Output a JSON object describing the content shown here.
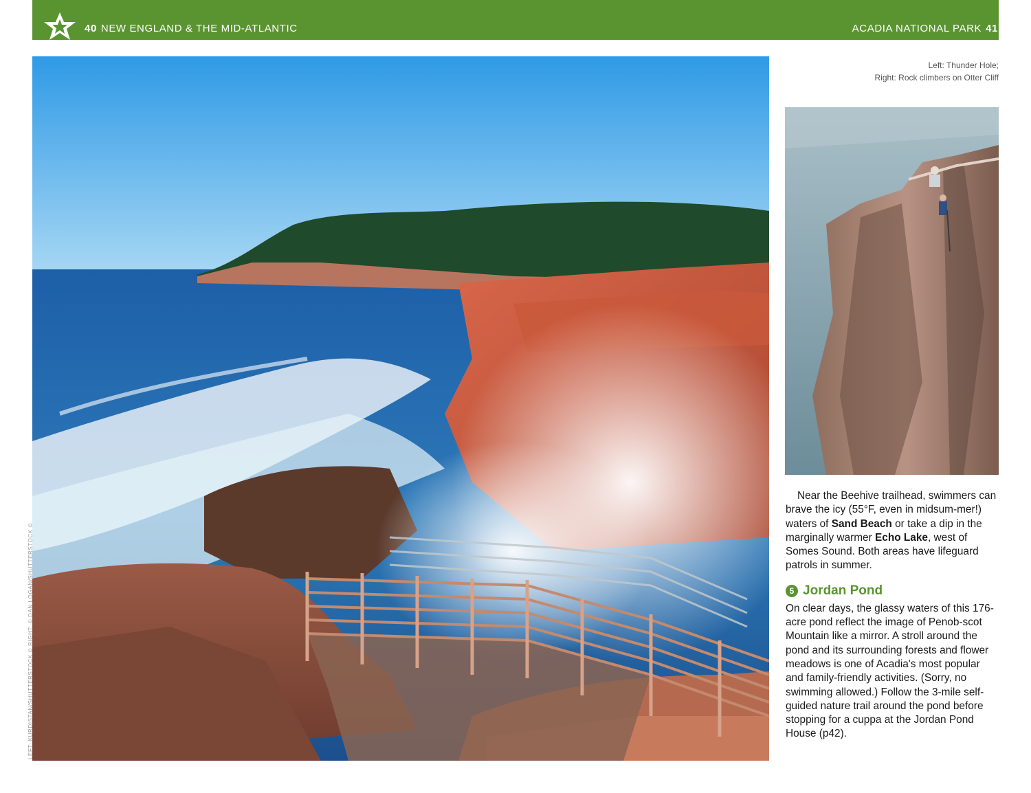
{
  "header": {
    "left_page_number": "40",
    "left_title": "NEW ENGLAND & THE MID-ATLANTIC",
    "right_title": "ACADIA NATIONAL PARK",
    "right_page_number": "41"
  },
  "caption": {
    "line1": "Left: Thunder Hole;",
    "line2": "Right: Rock climbers on Otter Cliff"
  },
  "photo_credit": "LEFT: KURDISTAN/SHUTTERSTOCK © RIGHT: © DAN LOGAN/SHUTTERSTOCK ©",
  "body": {
    "para1_a": "Near the Beehive trailhead, swimmers can brave the icy (55°F, even in midsum-mer!) waters of ",
    "para1_b": "Sand Beach",
    "para1_c": " or take a dip in the marginally warmer ",
    "para1_d": "Echo Lake",
    "para1_e": ", west of Somes Sound. Both areas have lifeguard patrols in summer.",
    "section_number": "5",
    "section_title": "Jordan Pond",
    "para2": "On clear days, the glassy waters of this 176-acre pond reflect the image of Penob-scot Mountain like a mirror. A stroll around the pond and its surrounding forests and flower meadows is one of Acadia's most popular and family-friendly activities. (Sorry, no swimming allowed.) Follow the 3-mile self-guided nature trail around the pond before stopping for a cuppa at the Jordan Pond House (p42)."
  },
  "colors": {
    "accent_green": "#5a9431"
  },
  "icons": {
    "header_badge": "star-icon"
  }
}
